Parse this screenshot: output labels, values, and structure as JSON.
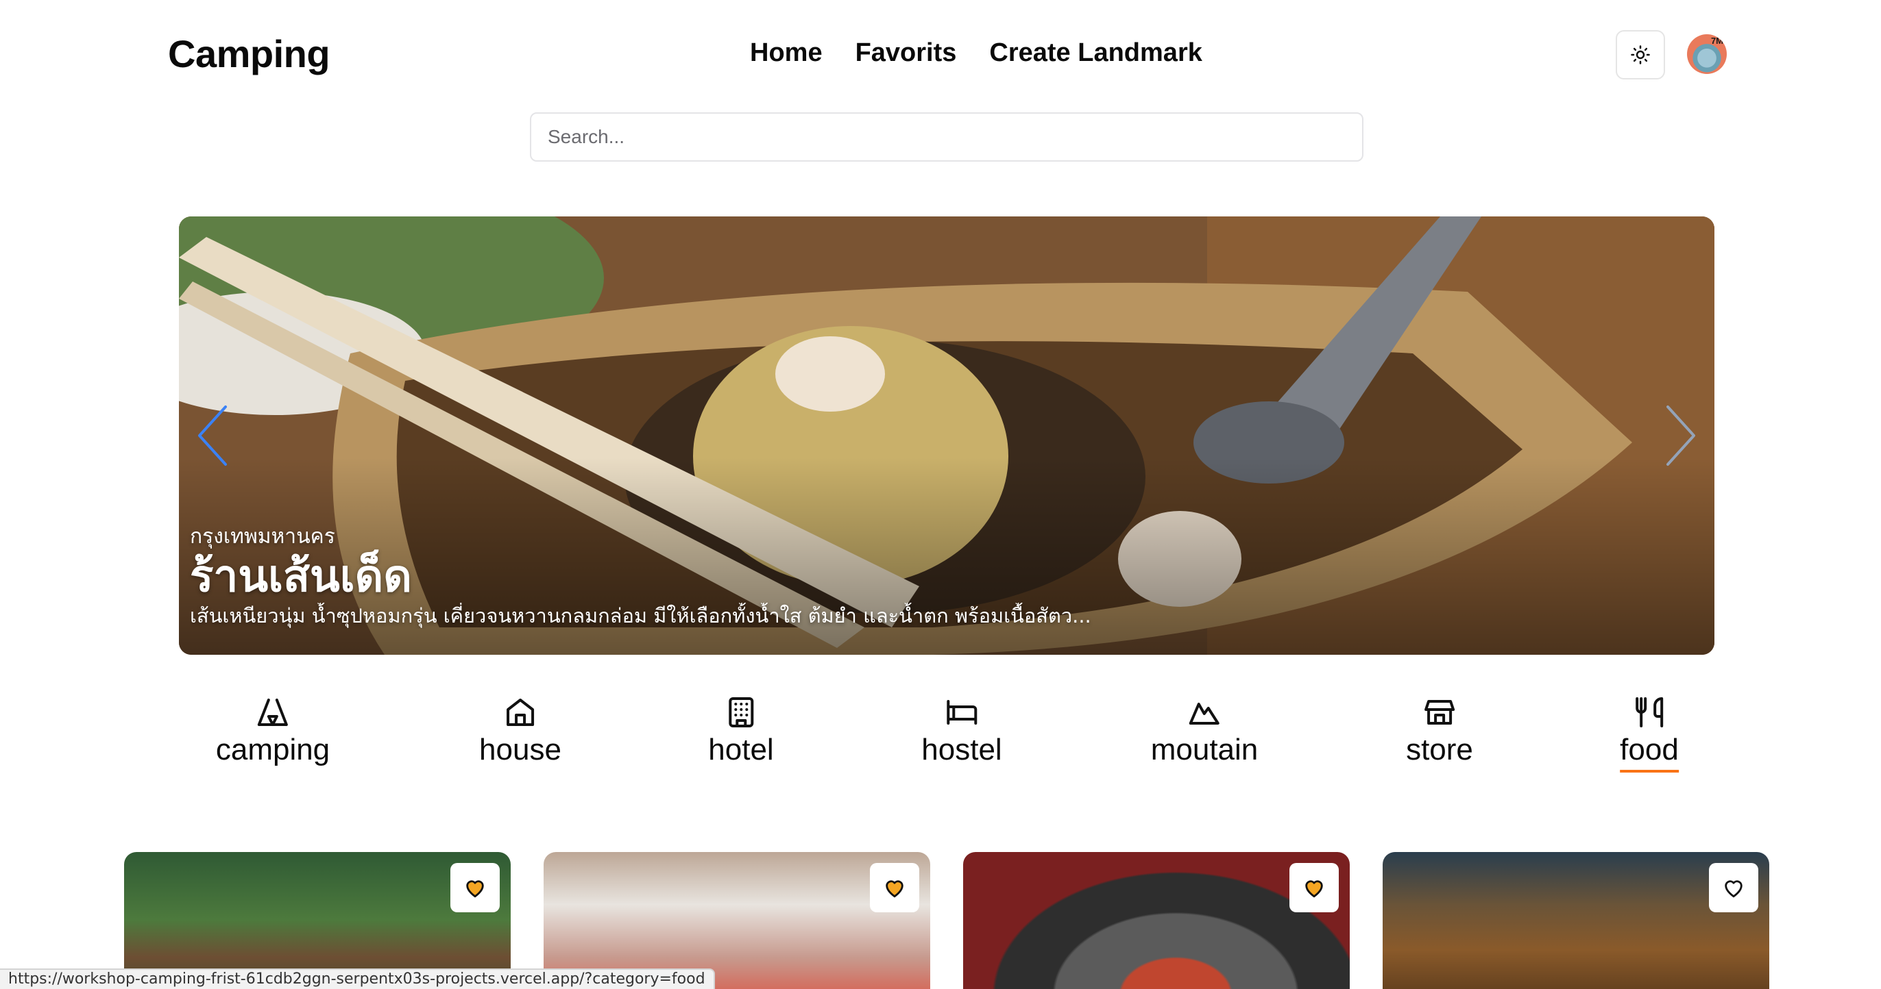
{
  "app": {
    "title": "Camping"
  },
  "nav": [
    "Home",
    "Favorits",
    "Create Landmark"
  ],
  "search": {
    "placeholder": "Search...",
    "value": ""
  },
  "hero": {
    "location": "กรุงเทพมหานคร",
    "title": "ร้านเส้นเด็ด",
    "description": "เส้นเหนียวนุ่ม น้ำซุปหอมกรุ่น เคี่ยวจนหวานกลมกล่อม มีให้เลือกทั้งน้ำใส ต้มยำ และน้ำตก พร้อมเนื้อสัตว..."
  },
  "categories": [
    {
      "label": "camping",
      "icon": "tent-icon"
    },
    {
      "label": "house",
      "icon": "house-icon"
    },
    {
      "label": "hotel",
      "icon": "building-icon"
    },
    {
      "label": "hostel",
      "icon": "bed-icon"
    },
    {
      "label": "moutain",
      "icon": "mountain-icon"
    },
    {
      "label": "store",
      "icon": "store-icon"
    },
    {
      "label": "food",
      "icon": "utensils-icon",
      "active": true
    }
  ],
  "cards": [
    {
      "favorited": true
    },
    {
      "favorited": true
    },
    {
      "favorited": true
    },
    {
      "favorited": false
    }
  ],
  "status_url": "https://workshop-camping-frist-61cdb2ggn-serpentx03s-projects.vercel.app/?category=food",
  "colors": {
    "accent": "#f97316",
    "favorite_fill": "#f5a623",
    "arrow_left": "#3b82f6",
    "arrow_right": "#94a3b8"
  }
}
